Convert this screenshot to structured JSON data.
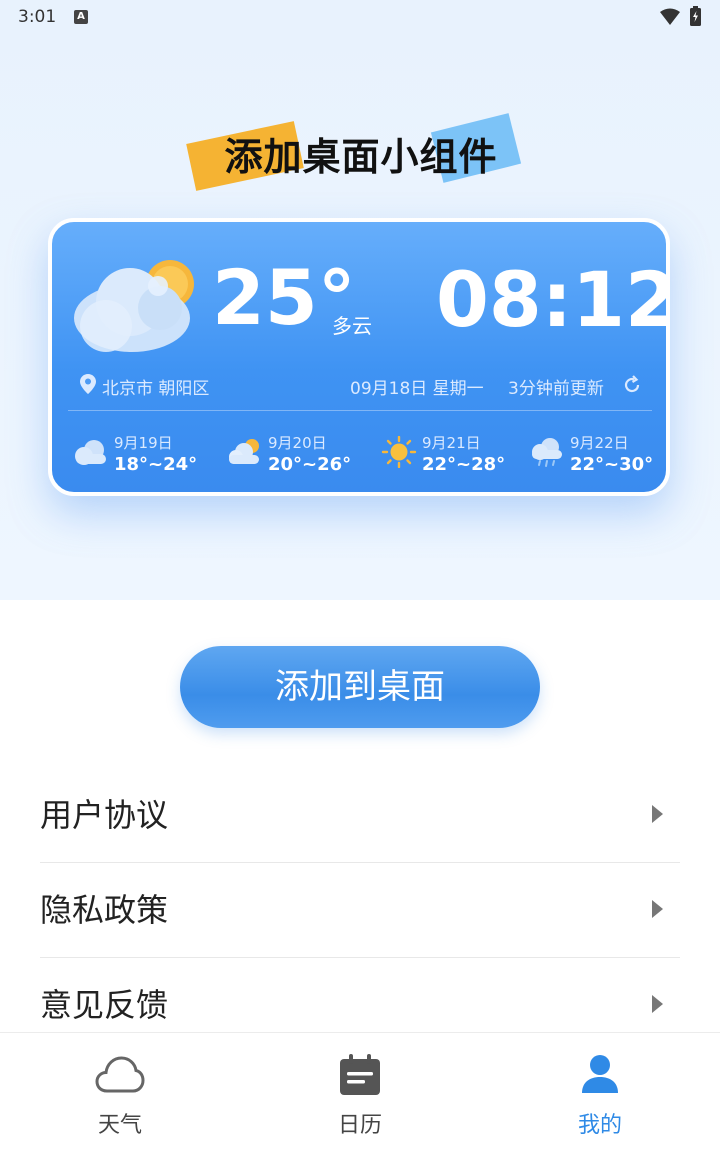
{
  "status_bar": {
    "time": "3:01",
    "notification_badge": "A"
  },
  "banner": {
    "title": "添加桌面小组件"
  },
  "widget": {
    "temperature": "25°",
    "condition": "多云",
    "clock": "08:12",
    "location": "北京市 朝阳区",
    "date": "09月18日 星期一",
    "updated": "3分钟前更新",
    "forecast": [
      {
        "date": "9月19日",
        "temp": "18°~24°",
        "icon": "cloudy-icon"
      },
      {
        "date": "9月20日",
        "temp": "20°~26°",
        "icon": "partly-cloudy-icon"
      },
      {
        "date": "9月21日",
        "temp": "22°~28°",
        "icon": "sunny-icon"
      },
      {
        "date": "9月22日",
        "temp": "22°~30°",
        "icon": "rain-icon"
      }
    ]
  },
  "add_button": {
    "label": "添加到桌面"
  },
  "menu": {
    "items": [
      {
        "label": "用户协议"
      },
      {
        "label": "隐私政策"
      },
      {
        "label": "意见反馈"
      }
    ]
  },
  "bottom_nav": {
    "items": [
      {
        "label": "天气",
        "icon": "cloud-icon"
      },
      {
        "label": "日历",
        "icon": "calendar-icon"
      },
      {
        "label": "我的",
        "icon": "user-icon"
      }
    ],
    "active_color": "#2f8ae6"
  }
}
